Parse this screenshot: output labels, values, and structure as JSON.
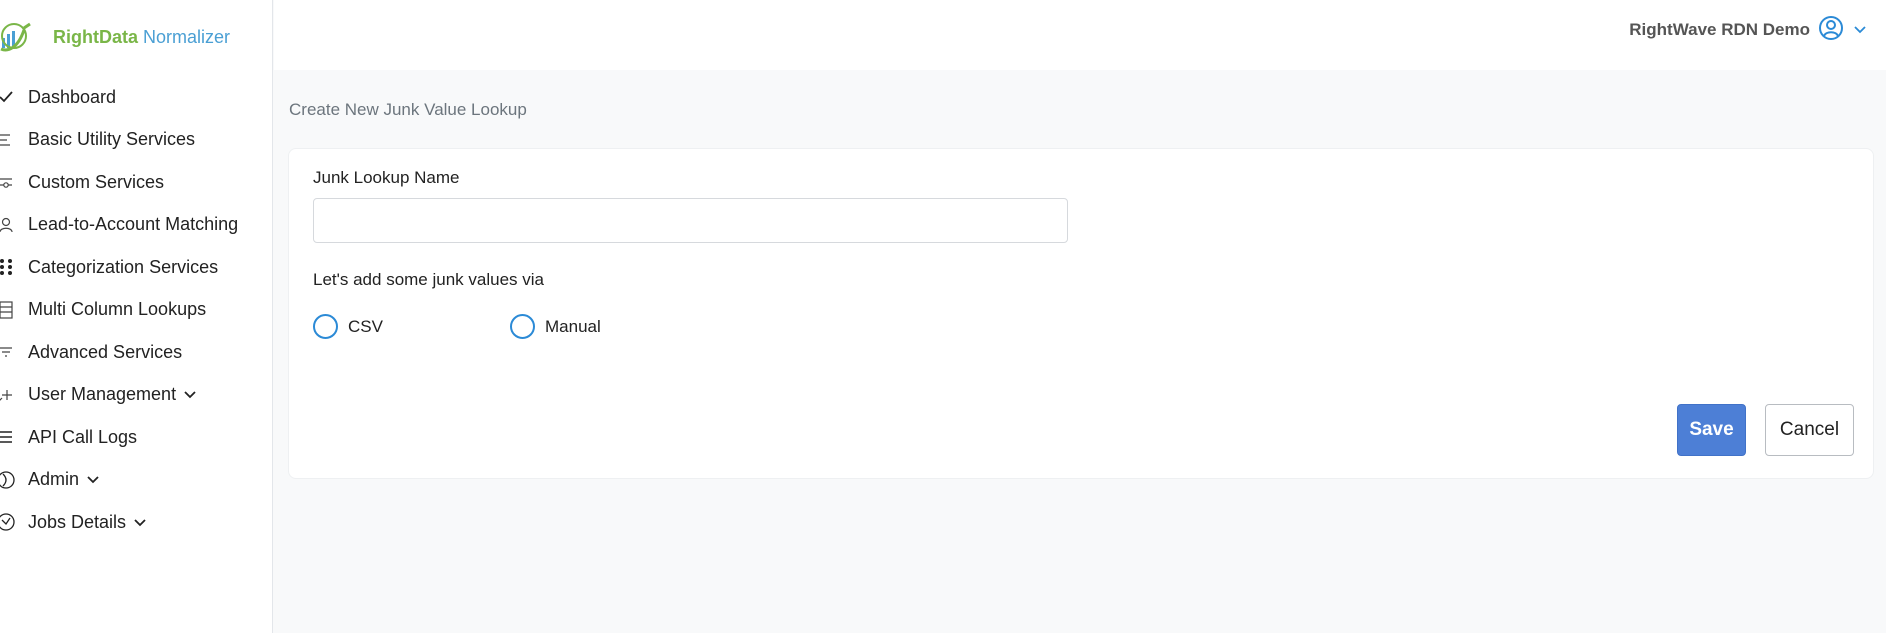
{
  "brand": {
    "name_part1": "RightData",
    "name_part2": "Normalizer"
  },
  "sidebar": {
    "items": [
      {
        "label": "Dashboard",
        "icon": "check-icon"
      },
      {
        "label": "Basic Utility Services",
        "icon": "list-icon"
      },
      {
        "label": "Custom Services",
        "icon": "sliders-icon"
      },
      {
        "label": "Lead-to-Account Matching",
        "icon": "user-icon"
      },
      {
        "label": "Categorization Services",
        "icon": "grid-dots-icon"
      },
      {
        "label": "Multi Column Lookups",
        "icon": "table-icon"
      },
      {
        "label": "Advanced Services",
        "icon": "filter-icon"
      },
      {
        "label": "User Management",
        "icon": "user-plus-icon",
        "has_submenu": true
      },
      {
        "label": "API Call Logs",
        "icon": "lines-icon"
      },
      {
        "label": "Admin",
        "icon": "admin-icon",
        "has_submenu": true
      },
      {
        "label": "Jobs Details",
        "icon": "clock-icon",
        "has_submenu": true
      }
    ]
  },
  "header": {
    "user_name": "RightWave RDN Demo"
  },
  "main": {
    "page_title": "Create New Junk Value Lookup",
    "form": {
      "name_label": "Junk Lookup Name",
      "name_value": "",
      "name_placeholder": "",
      "via_label": "Let's add some junk values via",
      "options": [
        "CSV",
        "Manual"
      ],
      "save_label": "Save",
      "cancel_label": "Cancel"
    }
  },
  "colors": {
    "accent": "#4d7fd6",
    "radio": "#2b8ad6",
    "brand_green": "#7ab648",
    "brand_blue": "#4a9fd4"
  }
}
